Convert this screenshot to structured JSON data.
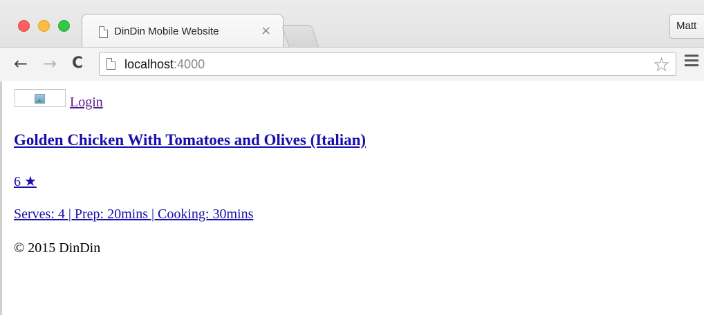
{
  "browser": {
    "tab": {
      "title": "DinDin Mobile Website",
      "close_glyph": "×",
      "icon": "page-icon"
    },
    "profile_label": "Matt",
    "nav": {
      "back_glyph": "←",
      "forward_glyph": "→",
      "reload_glyph": "C"
    },
    "address": {
      "host": "localhost",
      "port": ":4000"
    },
    "star_glyph": "☆",
    "colors": {
      "close": "#fc605c",
      "minimize": "#fdbc40",
      "zoom": "#34c84a"
    }
  },
  "page": {
    "logo_icon": "broken-image-icon",
    "login_label": "Login",
    "recipe": {
      "title": "Golden Chicken With Tomatoes and Olives (Italian)",
      "rating": "6 ★",
      "meta": "Serves: 4 | Prep: 20mins | Cooking: 30mins"
    },
    "footer": "© 2015 DinDin",
    "link_color": "#1a0dab"
  }
}
